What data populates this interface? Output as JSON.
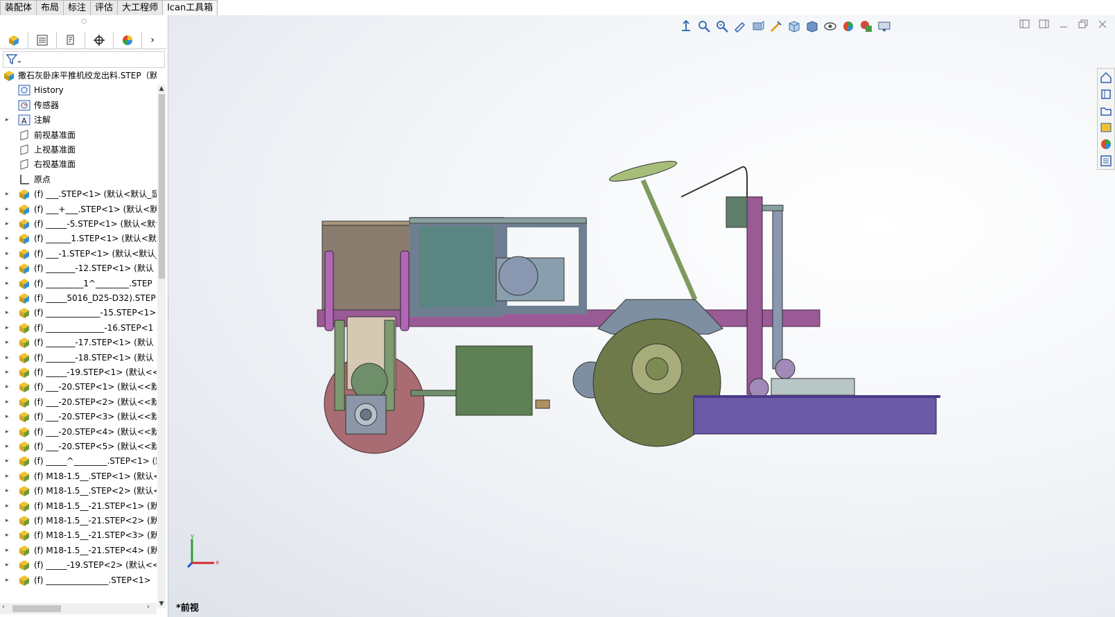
{
  "command_tabs": [
    "装配体",
    "布局",
    "标注",
    "评估",
    "大工程师",
    "Ican工具箱"
  ],
  "manager_tabs": [
    "featuremanager-icon",
    "propertymanager-icon",
    "configurationmanager-icon",
    "dimxpert-icon",
    "displaymanager-icon"
  ],
  "tree": {
    "root": "撒石灰卧床平推机绞龙出料.STEP（默",
    "items": [
      {
        "label": "History",
        "icon": "history-icon",
        "expandable": false
      },
      {
        "label": "传感器",
        "icon": "sensor-icon",
        "expandable": false
      },
      {
        "label": "注解",
        "icon": "annotation-icon",
        "expandable": true
      },
      {
        "label": "前视基准面",
        "icon": "plane-icon",
        "expandable": false
      },
      {
        "label": "上视基准面",
        "icon": "plane-icon",
        "expandable": false
      },
      {
        "label": "右视基准面",
        "icon": "plane-icon",
        "expandable": false
      },
      {
        "label": "原点",
        "icon": "origin-icon",
        "expandable": false
      },
      {
        "label": "(f) ___.STEP<1> (默认<默认_显",
        "icon": "part-icon",
        "expandable": true
      },
      {
        "label": "(f) ___+___.STEP<1> (默认<默",
        "icon": "part-icon",
        "expandable": true
      },
      {
        "label": "(f) _____-5.STEP<1> (默认<默认",
        "icon": "part-icon",
        "expandable": true
      },
      {
        "label": "(f) ______1.STEP<1> (默认<默",
        "icon": "part-icon",
        "expandable": true
      },
      {
        "label": "(f) ___-1.STEP<1> (默认<默认_",
        "icon": "part-icon",
        "expandable": true
      },
      {
        "label": "(f) _______-12.STEP<1> (默认",
        "icon": "part-icon",
        "expandable": true
      },
      {
        "label": "(f) _________1^________.STEP",
        "icon": "part-icon",
        "expandable": true
      },
      {
        "label": "(f) _____5016_D25-D32).STEP<",
        "icon": "part-icon",
        "expandable": true
      },
      {
        "label": "(f) _____________-15.STEP<1>",
        "icon": "asm-icon",
        "expandable": true
      },
      {
        "label": "(f) ______________-16.STEP<1",
        "icon": "asm-icon",
        "expandable": true
      },
      {
        "label": "(f) _______-17.STEP<1> (默认",
        "icon": "asm-icon",
        "expandable": true
      },
      {
        "label": "(f) _______-18.STEP<1> (默认",
        "icon": "asm-icon",
        "expandable": true
      },
      {
        "label": "(f) _____-19.STEP<1> (默认<<默",
        "icon": "asm-icon",
        "expandable": true
      },
      {
        "label": "(f) ___-20.STEP<1> (默认<<默",
        "icon": "asm-icon",
        "expandable": true
      },
      {
        "label": "(f) ___-20.STEP<2> (默认<<默",
        "icon": "asm-icon",
        "expandable": true
      },
      {
        "label": "(f) ___-20.STEP<3> (默认<<默",
        "icon": "asm-icon",
        "expandable": true
      },
      {
        "label": "(f) ___-20.STEP<4> (默认<<默",
        "icon": "asm-icon",
        "expandable": true
      },
      {
        "label": "(f) ___-20.STEP<5> (默认<<默",
        "icon": "asm-icon",
        "expandable": true
      },
      {
        "label": "(f) _____^________.STEP<1> (默",
        "icon": "asm-icon",
        "expandable": true
      },
      {
        "label": "(f) M18-1.5__.STEP<1> (默认<-",
        "icon": "asm-icon",
        "expandable": true
      },
      {
        "label": "(f) M18-1.5__.STEP<2> (默认<-",
        "icon": "asm-icon",
        "expandable": true
      },
      {
        "label": "(f) M18-1.5__-21.STEP<1> (默认",
        "icon": "asm-icon",
        "expandable": true
      },
      {
        "label": "(f) M18-1.5__-21.STEP<2> (默认",
        "icon": "asm-icon",
        "expandable": true
      },
      {
        "label": "(f) M18-1.5__-21.STEP<3> (默认",
        "icon": "asm-icon",
        "expandable": true
      },
      {
        "label": "(f) M18-1.5__-21.STEP<4> (默认",
        "icon": "asm-icon",
        "expandable": true
      },
      {
        "label": "(f) _____-19.STEP<2> (默认<<默",
        "icon": "asm-icon",
        "expandable": true
      },
      {
        "label": "(f) _______________.STEP<1>",
        "icon": "asm-icon",
        "expandable": true
      }
    ]
  },
  "viewport": {
    "view_name": "*前视",
    "triad": {
      "x": "x",
      "y": "y"
    }
  },
  "headsup_tools": [
    "zoom-to-fit-icon",
    "zoom-area-icon",
    "zoom-in-out-icon",
    "previous-view-icon",
    "section-view-icon",
    "dynamic-annotation-icon",
    "view-orientation-icon",
    "display-style-icon",
    "hide-show-icon",
    "edit-appearance-icon",
    "apply-scene-icon",
    "view-settings-icon"
  ],
  "task_pane": [
    "home-icon",
    "design-library-icon",
    "file-explorer-icon",
    "view-palette-icon",
    "appearances-icon",
    "custom-properties-icon"
  ],
  "colors": {
    "frame": "#9a5a95",
    "tire": "#6f7a4a",
    "roller": "#a86c72",
    "blade": "#6a5aa8",
    "box": "#566e54",
    "cab": "#5b8580"
  }
}
